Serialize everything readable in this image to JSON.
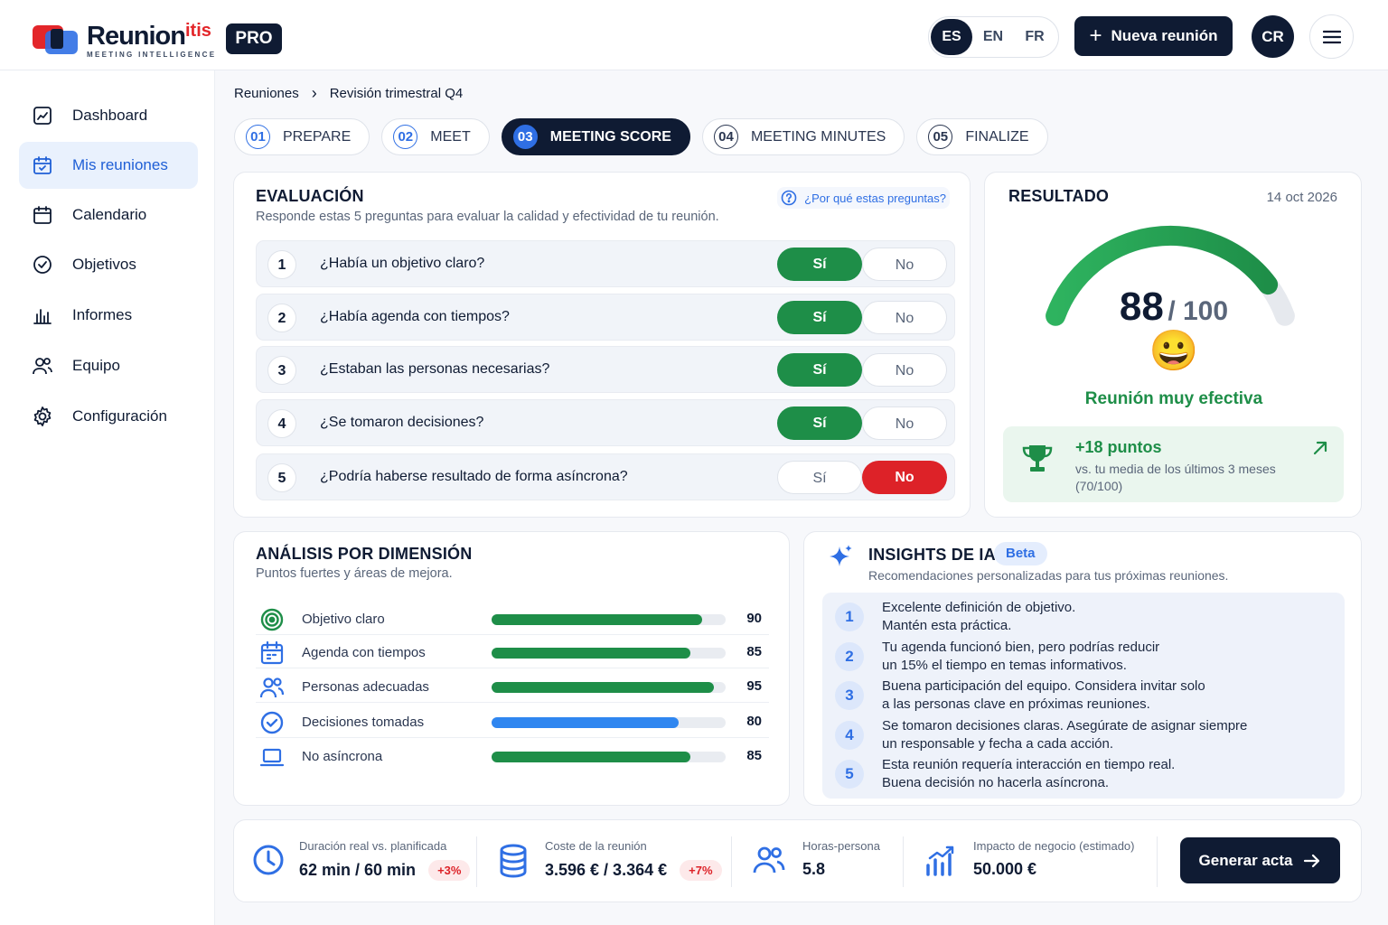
{
  "brand": {
    "name": "Reunion",
    "suffix": "itis",
    "tagline": "MEETING INTELLIGENCE",
    "plan": "PRO"
  },
  "header": {
    "languages": [
      {
        "code": "ES",
        "active": true
      },
      {
        "code": "EN",
        "active": false
      },
      {
        "code": "FR",
        "active": false
      }
    ],
    "new_meeting_label": "Nueva reunión",
    "user_initials": "CR",
    "menu_icon": "hamburger-icon"
  },
  "sidebar": {
    "items": [
      {
        "label": "Dashboard",
        "icon": "dashboard-icon",
        "active": false
      },
      {
        "label": "Mis reuniones",
        "icon": "calendar-check-icon",
        "active": true
      },
      {
        "label": "Calendario",
        "icon": "calendar-icon",
        "active": false
      },
      {
        "label": "Objetivos",
        "icon": "check-circle-icon",
        "active": false
      },
      {
        "label": "Informes",
        "icon": "bar-chart-icon",
        "active": false
      },
      {
        "label": "Equipo",
        "icon": "team-icon",
        "active": false
      },
      {
        "label": "Configuración",
        "icon": "gear-icon",
        "active": false
      }
    ]
  },
  "breadcrumb": {
    "parent": "Reuniones",
    "separator": "›",
    "current": "Revisión trimestral Q4"
  },
  "steps": [
    {
      "num": "01",
      "label": "PREPARE",
      "state": "done"
    },
    {
      "num": "02",
      "label": "MEET",
      "state": "done"
    },
    {
      "num": "03",
      "label": "MEETING SCORE",
      "state": "active"
    },
    {
      "num": "04",
      "label": "MEETING MINUTES",
      "state": "todo"
    },
    {
      "num": "05",
      "label": "FINALIZE",
      "state": "todo"
    }
  ],
  "evaluation": {
    "title": "EVALUACIÓN",
    "subtitle": "Responde estas 5 preguntas para evaluar la calidad y efectividad de tu reunión.",
    "help_link": "¿Por qué estas preguntas?",
    "yes_label": "Sí",
    "no_label": "No",
    "questions": [
      {
        "num": "1",
        "text": "¿Había un objetivo claro?",
        "answer": "yes"
      },
      {
        "num": "2",
        "text": "¿Había agenda con tiempos?",
        "answer": "yes"
      },
      {
        "num": "3",
        "text": "¿Estaban las personas necesarias?",
        "answer": "yes"
      },
      {
        "num": "4",
        "text": "¿Se tomaron decisiones?",
        "answer": "yes"
      },
      {
        "num": "5",
        "text": "¿Podría haberse resultado de forma asíncrona?",
        "answer": "no"
      }
    ]
  },
  "result": {
    "title": "RESULTADO",
    "date": "14 oct 2026",
    "score": 88,
    "max": 100,
    "max_label": "/ 100",
    "verdict": "Reunión muy efectiva",
    "emoji": "😀",
    "delta_title": "+18 puntos",
    "delta_sub": "vs. tu media de los últimos 3 meses (70/100)",
    "colors": {
      "accent": "#1e8e48",
      "accent_light": "#2eb35f",
      "track": "#e6e9ee"
    }
  },
  "dimensions": {
    "title": "ANÁLISIS POR DIMENSIÓN",
    "subtitle": "Puntos fuertes y áreas de mejora.",
    "items": [
      {
        "label": "Objetivo claro",
        "value": 90,
        "icon": "target-icon",
        "color": "#1e8e48"
      },
      {
        "label": "Agenda con tiempos",
        "value": 85,
        "icon": "calendar-icon",
        "color": "#1e8e48"
      },
      {
        "label": "Personas adecuadas",
        "value": 95,
        "icon": "team-icon",
        "color": "#1e8e48"
      },
      {
        "label": "Decisiones tomadas",
        "value": 80,
        "icon": "check-circle-icon",
        "color": "#2f86f0"
      },
      {
        "label": "No asíncrona",
        "value": 85,
        "icon": "laptop-icon",
        "color": "#1e8e48"
      }
    ]
  },
  "insights": {
    "title": "INSIGHTS DE IA",
    "badge": "Beta",
    "subtitle": "Recomendaciones personalizadas para tus próximas reuniones.",
    "items": [
      {
        "num": "1",
        "line1": "Excelente definición de objetivo.",
        "line2": "Mantén esta práctica."
      },
      {
        "num": "2",
        "line1": "Tu agenda funcionó bien, pero podrías reducir",
        "line2": "un 15% el tiempo en temas informativos."
      },
      {
        "num": "3",
        "line1": "Buena participación del equipo. Considera invitar solo",
        "line2": "a las personas clave en próximas reuniones."
      },
      {
        "num": "4",
        "line1": "Se tomaron decisiones claras. Asegúrate de asignar siempre",
        "line2": "un responsable y fecha a cada acción."
      },
      {
        "num": "5",
        "line1": "Esta reunión requería interacción en tiempo real.",
        "line2": "Buena decisión no hacerla asíncrona."
      }
    ]
  },
  "metrics": [
    {
      "label": "Duración real vs. planificada",
      "value": "62 min / 60 min",
      "badge": "+3%",
      "icon": "clock-icon"
    },
    {
      "label": "Coste de la reunión",
      "value": "3.596 € / 3.364 €",
      "badge": "+7%",
      "icon": "coins-icon"
    },
    {
      "label": "Horas-persona",
      "value": "5.8",
      "badge": "",
      "icon": "team-icon"
    },
    {
      "label": "Impacto de negocio (estimado)",
      "value": "50.000 €",
      "badge": "",
      "icon": "growth-chart-icon"
    }
  ],
  "generate_label": "Generar acta"
}
